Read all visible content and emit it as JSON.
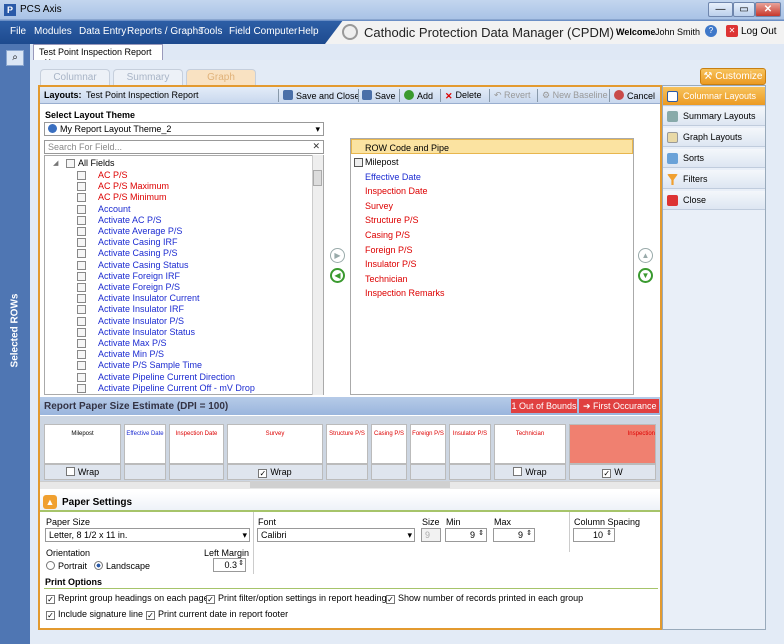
{
  "window": {
    "title": "PCS Axis",
    "min": "—",
    "max": "▭",
    "close": "✕"
  },
  "menu": [
    "File",
    "Modules",
    "Data Entry",
    "Reports / Graphs",
    "Tools",
    "Field Computer",
    "Help"
  ],
  "header": {
    "app_title": "Cathodic Protection Data Manager (CPDM)",
    "welcome_label": "Welcome",
    "user": "John Smith",
    "logout": "Log Out"
  },
  "rail": {
    "label": "Selected ROWs"
  },
  "doc_tab": {
    "label": "Test Point Inspection Report",
    "close": "✕"
  },
  "view_tabs": [
    "Columnar",
    "Summary",
    "Graph"
  ],
  "customize": "Customize",
  "layouts_bar": {
    "label": "Layouts:",
    "name": "Test Point Inspection Report",
    "save_close": "Save and Close",
    "save": "Save",
    "add": "Add",
    "delete": "Delete",
    "revert": "Revert",
    "new_baseline": "New Baseline",
    "cancel": "Cancel"
  },
  "theme": {
    "label": "Select Layout Theme",
    "value": "My Report Layout Theme_2"
  },
  "search": {
    "placeholder": "Search For Field..."
  },
  "field_root": "All Fields",
  "fields": [
    {
      "name": "AC P/S",
      "color": "red"
    },
    {
      "name": "AC P/S Maximum",
      "color": "red"
    },
    {
      "name": "AC P/S Minimum",
      "color": "red"
    },
    {
      "name": "Account",
      "color": "blue"
    },
    {
      "name": "Activate AC P/S",
      "color": "blue"
    },
    {
      "name": "Activate Average P/S",
      "color": "blue"
    },
    {
      "name": "Activate Casing IRF",
      "color": "blue"
    },
    {
      "name": "Activate Casing P/S",
      "color": "blue"
    },
    {
      "name": "Activate Casing Status",
      "color": "blue"
    },
    {
      "name": "Activate Foreign IRF",
      "color": "blue"
    },
    {
      "name": "Activate Foreign P/S",
      "color": "blue"
    },
    {
      "name": "Activate Insulator Current",
      "color": "blue"
    },
    {
      "name": "Activate Insulator IRF",
      "color": "blue"
    },
    {
      "name": "Activate Insulator P/S",
      "color": "blue"
    },
    {
      "name": "Activate Insulator Status",
      "color": "blue"
    },
    {
      "name": "Activate Max P/S",
      "color": "blue"
    },
    {
      "name": "Activate Min P/S",
      "color": "blue"
    },
    {
      "name": "Activate P/S Sample Time",
      "color": "blue"
    },
    {
      "name": "Activate Pipeline Current Direction",
      "color": "blue"
    },
    {
      "name": "Activate Pipeline Current Off - mV Drop",
      "color": "blue"
    }
  ],
  "selected": {
    "header": "ROW Code and Pipe",
    "items": [
      {
        "name": "Milepost",
        "color": "black"
      },
      {
        "name": "Effective Date",
        "color": "blue"
      },
      {
        "name": "Inspection Date",
        "color": "red"
      },
      {
        "name": "Survey",
        "color": "red"
      },
      {
        "name": "Structure P/S",
        "color": "red"
      },
      {
        "name": "Casing P/S",
        "color": "red"
      },
      {
        "name": "Foreign P/S",
        "color": "red"
      },
      {
        "name": "Insulator P/S",
        "color": "red"
      },
      {
        "name": "Technician",
        "color": "red"
      },
      {
        "name": "Inspection Remarks",
        "color": "red"
      }
    ]
  },
  "estimate": {
    "title": "Report Paper Size Estimate (DPI = 100)",
    "out_of_bounds": "1 Out of Bounds",
    "first_occurrence": "First Occurance"
  },
  "paper_columns": [
    {
      "label": "Milepost",
      "color": "#000",
      "wrap": "Wrap",
      "checked": false
    },
    {
      "label": "Effective Date",
      "color": "#1c2bd1"
    },
    {
      "label": "Inspection Date",
      "color": "#d00"
    },
    {
      "label": "Survey",
      "color": "#d00",
      "wrap": "Wrap",
      "checked": true
    },
    {
      "label": "Structure P/S",
      "color": "#d00"
    },
    {
      "label": "Casing P/S",
      "color": "#d00"
    },
    {
      "label": "Foreign P/S",
      "color": "#d00"
    },
    {
      "label": "Insulator P/S",
      "color": "#d00"
    },
    {
      "label": "Technician",
      "color": "#d00",
      "wrap": "Wrap",
      "checked": false
    },
    {
      "label": "Inspection",
      "color": "#d00",
      "wrap": "W",
      "checked": true
    }
  ],
  "paper_settings": {
    "title": "Paper Settings",
    "paper_size_label": "Paper Size",
    "paper_size": "Letter, 8 1/2 x 11 in.",
    "font_label": "Font",
    "font": "Calibri",
    "size_label": "Size",
    "size": "9",
    "min_label": "Min",
    "min": "9",
    "max_label": "Max",
    "max": "9",
    "col_spacing_label": "Column Spacing",
    "col_spacing": "10",
    "orientation_label": "Orientation",
    "portrait": "Portrait",
    "landscape": "Landscape",
    "left_margin_label": "Left Margin",
    "left_margin": "0.3",
    "print_options_label": "Print Options",
    "opt1": "Reprint group headings on each page",
    "opt2": "Print filter/option settings in report heading",
    "opt3": "Show number of records printed in each group",
    "opt4": "Include signature line",
    "opt5": "Print current date in report footer"
  },
  "right_menu": [
    "Columnar Layouts",
    "Summary Layouts",
    "Graph Layouts",
    "Sorts",
    "Filters",
    "Close"
  ]
}
